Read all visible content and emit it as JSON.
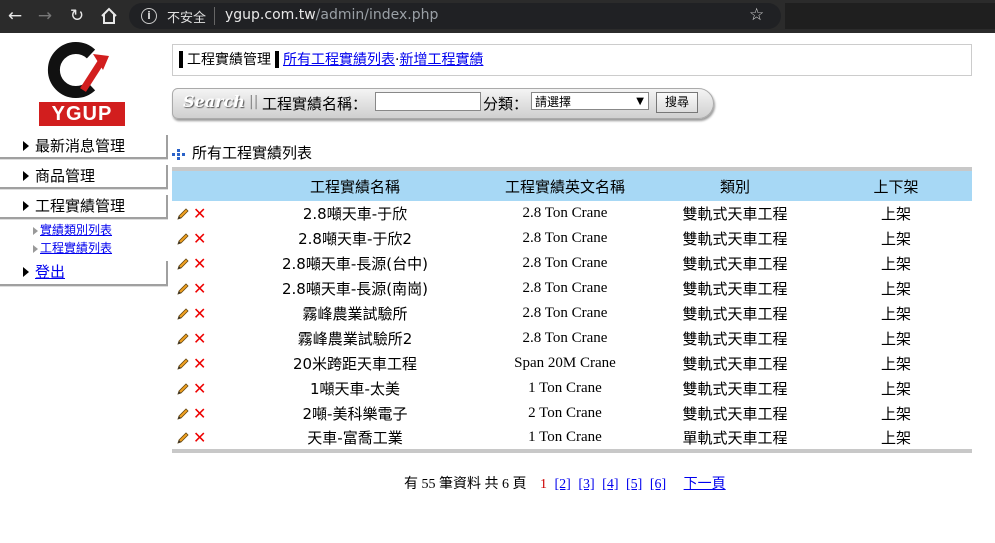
{
  "browser": {
    "insecure_label": "不安全",
    "url_domain": "ygup.com.tw",
    "url_path": "/admin/index.php"
  },
  "logo": {
    "text": "YGUP"
  },
  "sidebar": {
    "items": [
      {
        "label": "最新消息管理"
      },
      {
        "label": "商品管理"
      },
      {
        "label": "工程實績管理"
      }
    ],
    "subitems": [
      {
        "label": "實績類別列表"
      },
      {
        "label": "工程實績列表"
      }
    ],
    "logout": "登出"
  },
  "header": {
    "title": "工程實績管理",
    "link_list": "所有工程實績列表",
    "separator": "·",
    "link_add": "新增工程實績"
  },
  "search": {
    "brand": "Search",
    "name_label": "工程實績名稱：",
    "name_value": "",
    "category_label": "分類：",
    "category_selected": "請選擇",
    "button": "搜尋"
  },
  "list": {
    "title": "所有工程實績列表",
    "columns": [
      "工程實績名稱",
      "工程實績英文名稱",
      "類別",
      "上下架"
    ],
    "rows": [
      {
        "name": "2.8噸天車-于欣",
        "en": "2.8 Ton Crane",
        "type": "雙軌式天車工程",
        "status": "上架"
      },
      {
        "name": "2.8噸天車-于欣2",
        "en": "2.8 Ton Crane",
        "type": "雙軌式天車工程",
        "status": "上架"
      },
      {
        "name": "2.8噸天車-長源(台中)",
        "en": "2.8 Ton Crane",
        "type": "雙軌式天車工程",
        "status": "上架"
      },
      {
        "name": "2.8噸天車-長源(南崗)",
        "en": "2.8 Ton Crane",
        "type": "雙軌式天車工程",
        "status": "上架"
      },
      {
        "name": "霧峰農業試驗所",
        "en": "2.8 Ton Crane",
        "type": "雙軌式天車工程",
        "status": "上架"
      },
      {
        "name": "霧峰農業試驗所2",
        "en": "2.8 Ton Crane",
        "type": "雙軌式天車工程",
        "status": "上架"
      },
      {
        "name": "20米跨距天車工程",
        "en": "Span 20M Crane",
        "type": "雙軌式天車工程",
        "status": "上架"
      },
      {
        "name": "1噸天車-太美",
        "en": "1 Ton Crane",
        "type": "雙軌式天車工程",
        "status": "上架"
      },
      {
        "name": "2噸-美科樂電子",
        "en": "2 Ton Crane",
        "type": "雙軌式天車工程",
        "status": "上架"
      },
      {
        "name": "天車-富喬工業",
        "en": "1 Ton Crane",
        "type": "單軌式天車工程",
        "status": "上架"
      }
    ]
  },
  "pager": {
    "summary": "有 55 筆資料 共 6 頁",
    "current": "1",
    "pages": [
      "[2]",
      "[3]",
      "[4]",
      "[5]",
      "[6]"
    ],
    "next": "下一頁"
  },
  "colors": {
    "table_header_bg": "#a7d8f5",
    "link": "#0000ee",
    "logo_red": "#d21e1e",
    "delete_red": "#e00000"
  },
  "icons": [
    "back-arrow-icon",
    "forward-arrow-icon",
    "reload-icon",
    "home-icon",
    "info-icon",
    "star-icon",
    "edit-pencil-icon",
    "delete-x-icon"
  ]
}
